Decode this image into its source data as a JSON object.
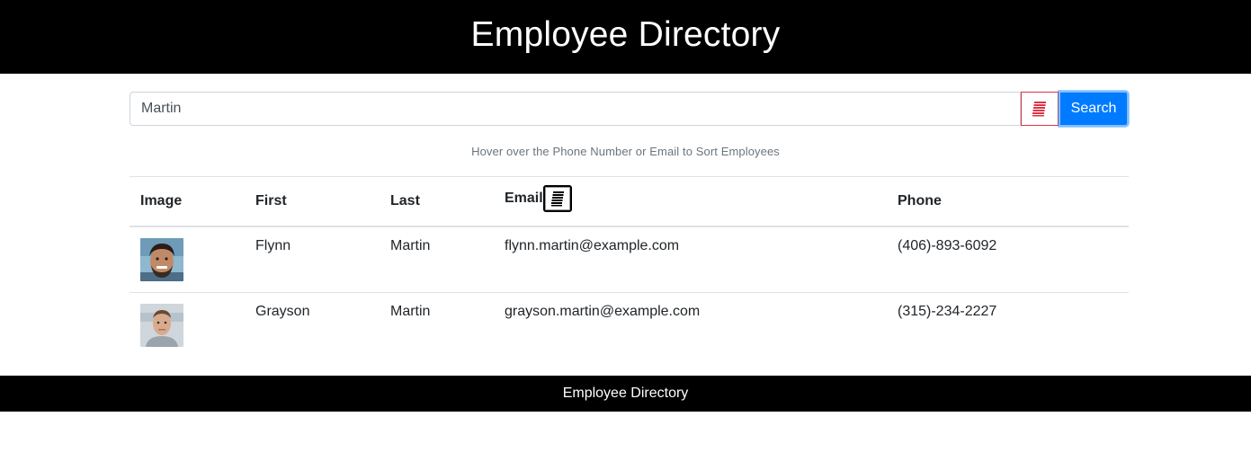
{
  "header": {
    "title": "Employee Directory"
  },
  "search": {
    "value": "Martin",
    "button_label": "Search",
    "clear_icon": "list-icon"
  },
  "hint": "Hover over the Phone Number or Email to Sort Employees",
  "table": {
    "columns": [
      "Image",
      "First",
      "Last",
      "Email",
      "Phone"
    ],
    "sort_icon": "list-icon",
    "rows": [
      {
        "first": "Flynn",
        "last": "Martin",
        "email": "flynn.martin@example.com",
        "phone": "(406)-893-6092",
        "avatar": "avatar-photo"
      },
      {
        "first": "Grayson",
        "last": "Martin",
        "email": "grayson.martin@example.com",
        "phone": "(315)-234-2227",
        "avatar": "avatar-photo"
      }
    ]
  },
  "footer": {
    "text": "Employee Directory"
  },
  "colors": {
    "header_bg": "#000000",
    "primary": "#007bff",
    "danger": "#dc3545"
  }
}
